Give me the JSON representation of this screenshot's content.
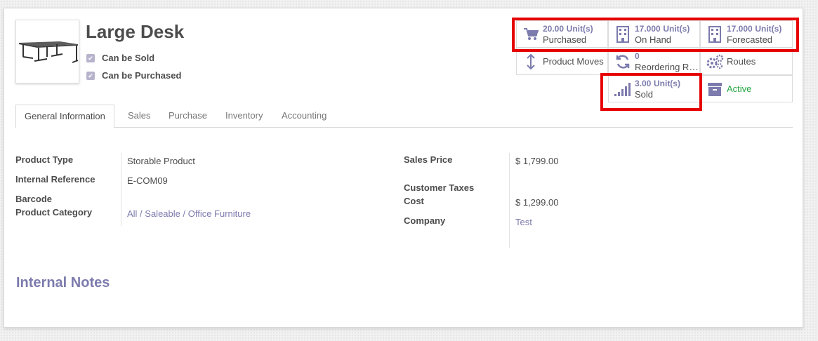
{
  "product": {
    "name": "Large Desk",
    "can_be_sold_label": "Can be Sold",
    "can_be_purchased_label": "Can be Purchased",
    "can_be_sold": true,
    "can_be_purchased": true
  },
  "smart_buttons": {
    "purchased": {
      "value": "20.00",
      "unit": "Unit(s)",
      "label": "Purchased",
      "icon": "cart-icon"
    },
    "on_hand": {
      "value": "17.000",
      "unit": "Unit(s)",
      "label": "On Hand",
      "icon": "building-icon"
    },
    "forecasted": {
      "value": "17.000",
      "unit": "Unit(s)",
      "label": "Forecasted",
      "icon": "building-icon"
    },
    "product_moves": {
      "label": "Product Moves",
      "icon": "arrows-vertical-icon"
    },
    "reordering": {
      "value": "0",
      "label": "Reordering R…",
      "icon": "refresh-icon"
    },
    "routes": {
      "label": "Routes",
      "icon": "gears-icon"
    },
    "sold": {
      "value": "3.00",
      "unit": "Unit(s)",
      "label": "Sold",
      "icon": "signal-bars-icon"
    },
    "active": {
      "label": "Active",
      "icon": "archive-icon"
    }
  },
  "tabs": [
    {
      "label": "General Information",
      "active": true
    },
    {
      "label": "Sales",
      "active": false
    },
    {
      "label": "Purchase",
      "active": false
    },
    {
      "label": "Inventory",
      "active": false
    },
    {
      "label": "Accounting",
      "active": false
    }
  ],
  "fields_left": {
    "product_type": {
      "label": "Product Type",
      "value": "Storable Product"
    },
    "internal_reference": {
      "label": "Internal Reference",
      "value": "E-COM09"
    },
    "barcode": {
      "label": "Barcode",
      "value": ""
    },
    "product_category": {
      "label": "Product Category",
      "value": "All / Saleable / Office Furniture"
    }
  },
  "fields_right": {
    "sales_price": {
      "label": "Sales Price",
      "value": "$ 1,799.00"
    },
    "customer_taxes": {
      "label": "Customer Taxes",
      "value": ""
    },
    "cost": {
      "label": "Cost",
      "value": "$ 1,299.00"
    },
    "company": {
      "label": "Company",
      "value": "Test"
    }
  },
  "internal_notes_title": "Internal Notes",
  "colors": {
    "accent": "#7c7bad",
    "active_green": "#28a745",
    "highlight_red": "#e60000"
  }
}
